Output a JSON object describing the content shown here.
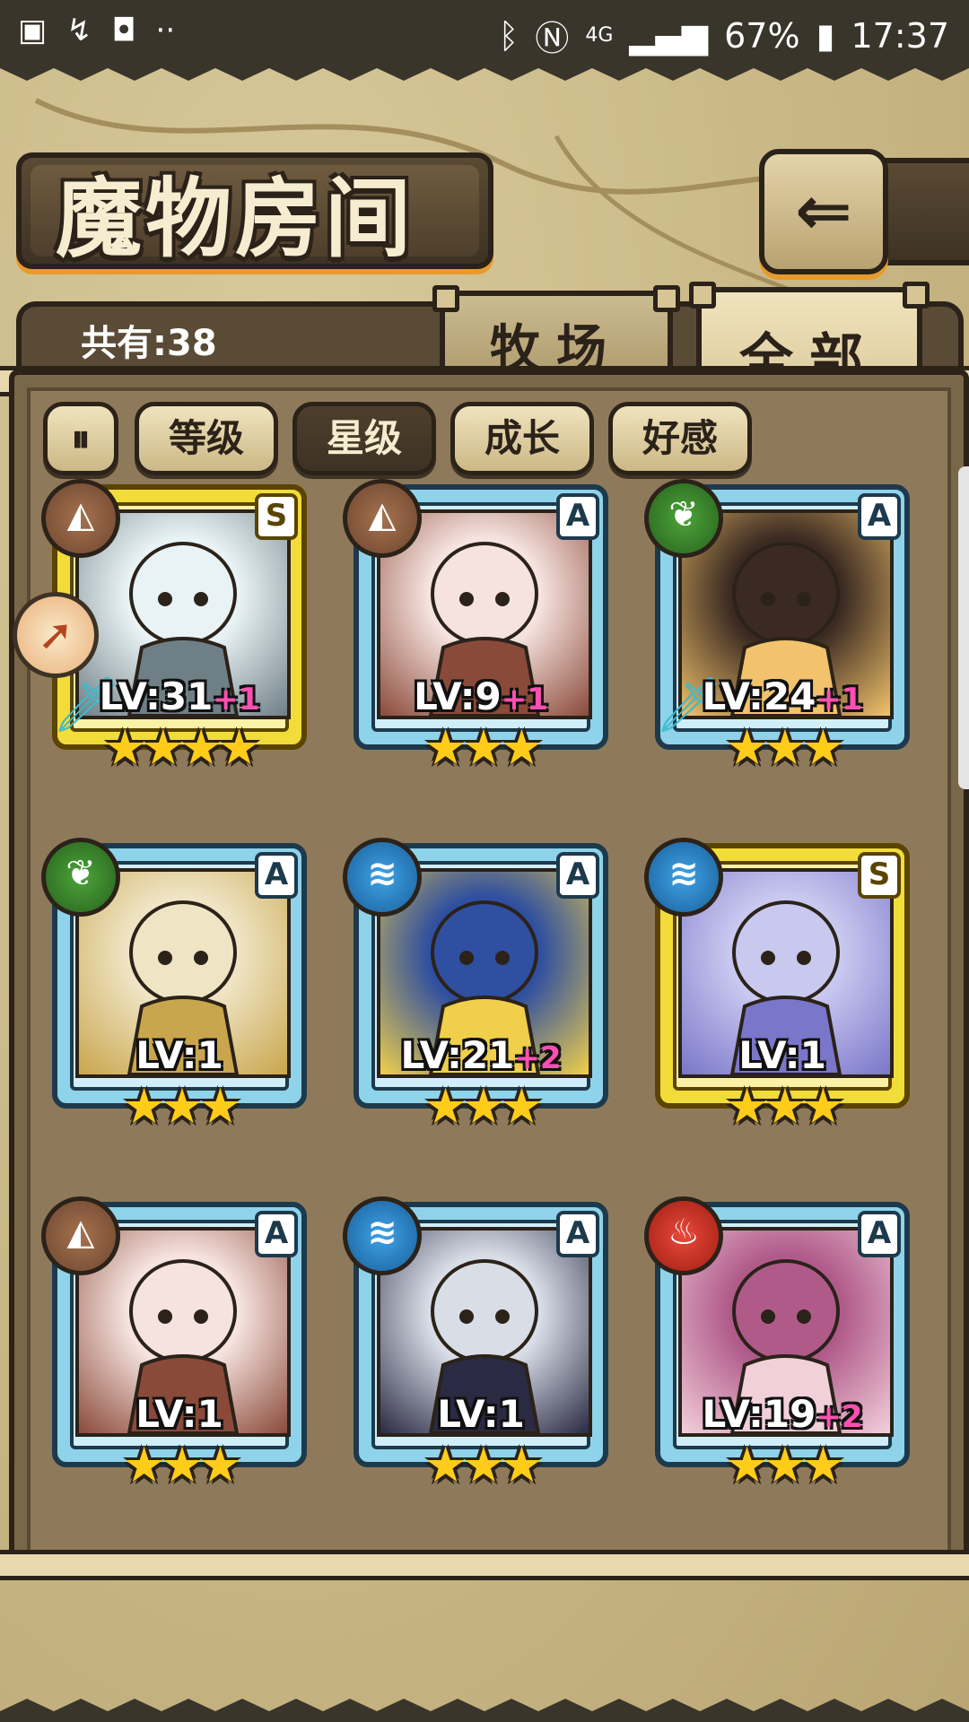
{
  "status_bar": {
    "left_icons": [
      "image-icon",
      "missed-call-icon",
      "shopping-bag-icon",
      "more-icon"
    ],
    "network": "4G",
    "battery": "67%",
    "time": "17:37"
  },
  "header": {
    "title": "魔物房间",
    "back_icon": "⇐"
  },
  "summary": {
    "count_label": "共有:38"
  },
  "tabs": [
    {
      "label": "牧场",
      "selected": false
    },
    {
      "label": "全部",
      "selected": true
    }
  ],
  "sort_buttons": [
    {
      "label": "等级",
      "active": false
    },
    {
      "label": "星级",
      "active": true
    },
    {
      "label": "成长",
      "active": false
    },
    {
      "label": "好感",
      "active": false
    }
  ],
  "monsters": [
    {
      "rank": "S",
      "element": "earth",
      "level": "LV:31",
      "bonus": "+1",
      "stars": "★★★★",
      "weapon": true,
      "frame": "gold"
    },
    {
      "rank": "A",
      "element": "earth",
      "level": "LV:9",
      "bonus": "+1",
      "stars": "★★★",
      "weapon": false,
      "frame": "blue"
    },
    {
      "rank": "A",
      "element": "grass",
      "level": "LV:24",
      "bonus": "+1",
      "stars": "★★★",
      "weapon": true,
      "frame": "blue"
    },
    {
      "rank": "A",
      "element": "grass",
      "level": "LV:1",
      "bonus": "",
      "stars": "★★★",
      "weapon": false,
      "frame": "blue"
    },
    {
      "rank": "A",
      "element": "water",
      "level": "LV:21",
      "bonus": "+2",
      "stars": "★★★",
      "weapon": false,
      "frame": "blue"
    },
    {
      "rank": "S",
      "element": "water",
      "level": "LV:1",
      "bonus": "",
      "stars": "★★★",
      "weapon": false,
      "frame": "gold"
    },
    {
      "rank": "A",
      "element": "earth",
      "level": "LV:1",
      "bonus": "",
      "stars": "★★★",
      "weapon": false,
      "frame": "blue"
    },
    {
      "rank": "A",
      "element": "water",
      "level": "LV:1",
      "bonus": "",
      "stars": "★★★",
      "weapon": false,
      "frame": "blue"
    },
    {
      "rank": "A",
      "element": "fire",
      "level": "LV:19",
      "bonus": "+2",
      "stars": "★★★",
      "weapon": false,
      "frame": "blue"
    }
  ],
  "colors": {
    "gold_frame": "#f2dc3a",
    "blue_frame": "#8fd3ea",
    "plus_text": "#ff4fb2",
    "star": "#ffcc1a"
  }
}
